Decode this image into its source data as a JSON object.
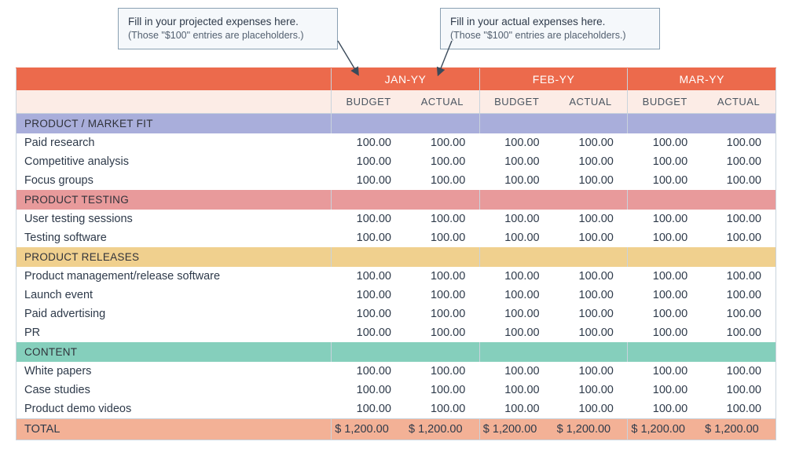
{
  "callouts": {
    "projected": {
      "line1": "Fill in your projected expenses here.",
      "line2": "(Those \"$100\" entries are placeholders.)"
    },
    "actual": {
      "line1": "Fill in your actual expenses here.",
      "line2": "(Those \"$100\" entries are placeholders.)"
    }
  },
  "months": [
    "JAN-YY",
    "FEB-YY",
    "MAR-YY"
  ],
  "subheaders": [
    "BUDGET",
    "ACTUAL"
  ],
  "sections": [
    {
      "name": "PRODUCT / MARKET FIT",
      "color": "purple",
      "rows": [
        {
          "label": "Paid research",
          "values": [
            "100.00",
            "100.00",
            "100.00",
            "100.00",
            "100.00",
            "100.00"
          ]
        },
        {
          "label": "Competitive analysis",
          "values": [
            "100.00",
            "100.00",
            "100.00",
            "100.00",
            "100.00",
            "100.00"
          ]
        },
        {
          "label": "Focus groups",
          "values": [
            "100.00",
            "100.00",
            "100.00",
            "100.00",
            "100.00",
            "100.00"
          ]
        }
      ]
    },
    {
      "name": "PRODUCT TESTING",
      "color": "rose",
      "rows": [
        {
          "label": "User testing sessions",
          "values": [
            "100.00",
            "100.00",
            "100.00",
            "100.00",
            "100.00",
            "100.00"
          ]
        },
        {
          "label": "Testing software",
          "values": [
            "100.00",
            "100.00",
            "100.00",
            "100.00",
            "100.00",
            "100.00"
          ]
        }
      ]
    },
    {
      "name": "PRODUCT RELEASES",
      "color": "gold",
      "rows": [
        {
          "label": "Product management/release software",
          "values": [
            "100.00",
            "100.00",
            "100.00",
            "100.00",
            "100.00",
            "100.00"
          ]
        },
        {
          "label": "Launch event",
          "values": [
            "100.00",
            "100.00",
            "100.00",
            "100.00",
            "100.00",
            "100.00"
          ]
        },
        {
          "label": "Paid advertising",
          "values": [
            "100.00",
            "100.00",
            "100.00",
            "100.00",
            "100.00",
            "100.00"
          ]
        },
        {
          "label": "PR",
          "values": [
            "100.00",
            "100.00",
            "100.00",
            "100.00",
            "100.00",
            "100.00"
          ]
        }
      ]
    },
    {
      "name": "CONTENT",
      "color": "teal",
      "rows": [
        {
          "label": "White papers",
          "values": [
            "100.00",
            "100.00",
            "100.00",
            "100.00",
            "100.00",
            "100.00"
          ]
        },
        {
          "label": "Case studies",
          "values": [
            "100.00",
            "100.00",
            "100.00",
            "100.00",
            "100.00",
            "100.00"
          ]
        },
        {
          "label": "Product demo videos",
          "values": [
            "100.00",
            "100.00",
            "100.00",
            "100.00",
            "100.00",
            "100.00"
          ]
        }
      ]
    }
  ],
  "total": {
    "label": "TOTAL",
    "values": [
      "$  1,200.00",
      "$  1,200.00",
      "$  1,200.00",
      "$  1,200.00",
      "$  1,200.00",
      "$  1,200.00"
    ]
  }
}
